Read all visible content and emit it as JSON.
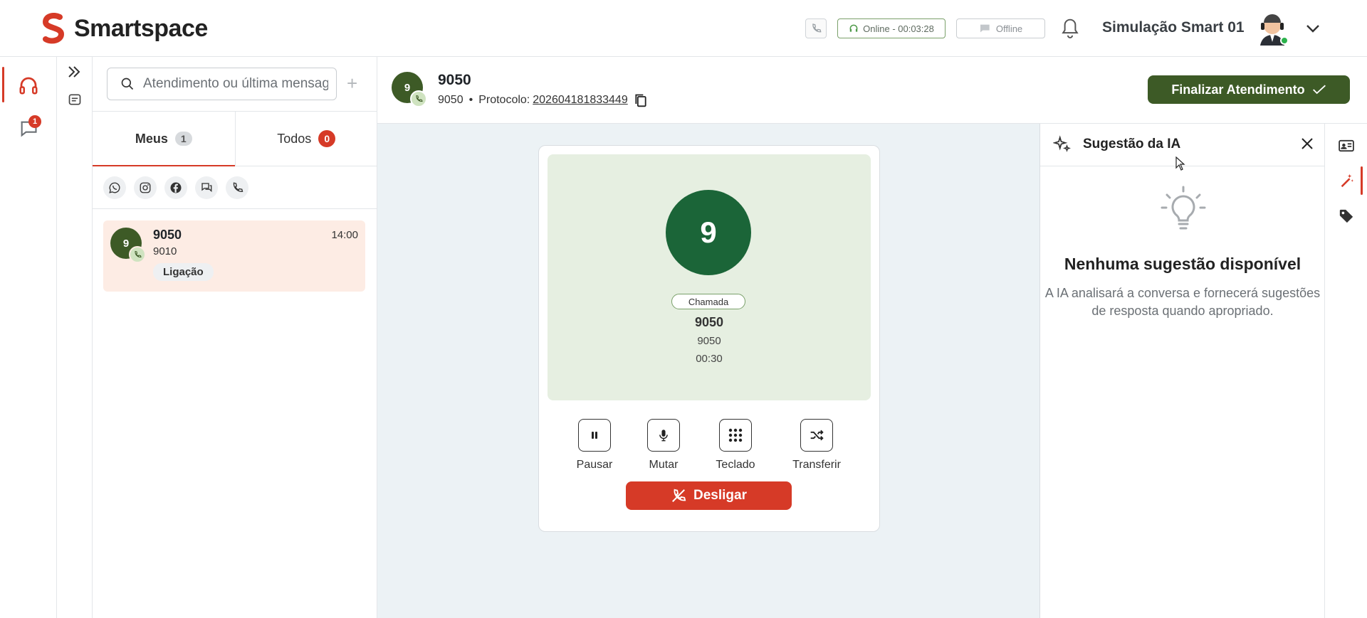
{
  "app": {
    "name": "Smartspace"
  },
  "topbar": {
    "status_online": "Online - 00:03:28",
    "status_offline": "Offline",
    "user_name": "Simulação Smart 01"
  },
  "rail": {
    "chat_badge": "1"
  },
  "list": {
    "search_placeholder": "Atendimento ou última mensagem",
    "plus_label": "+",
    "tabs": [
      {
        "label": "Meus",
        "count": "1"
      },
      {
        "label": "Todos",
        "count": "0"
      }
    ],
    "channels": [
      "whatsapp-icon",
      "instagram-icon",
      "facebook-icon",
      "chat-icon",
      "phone-icon"
    ],
    "conversations": [
      {
        "avatar": "9",
        "name": "9050",
        "time": "14:00",
        "subtitle": "9010",
        "tag": "Ligação"
      }
    ]
  },
  "header": {
    "avatar": "9",
    "title": "9050",
    "number": "9050",
    "separator": "•",
    "protocol_label": "Protocolo:",
    "protocol_number": "202604181833449",
    "finalize_label": "Finalizar Atendimento"
  },
  "call": {
    "avatar": "9",
    "badge": "Chamada",
    "name": "9050",
    "number": "9050",
    "timer": "00:30",
    "controls": [
      {
        "label": "Pausar",
        "icon": "pause-icon"
      },
      {
        "label": "Mutar",
        "icon": "mic-icon"
      },
      {
        "label": "Teclado",
        "icon": "keypad-icon"
      },
      {
        "label": "Transferir",
        "icon": "shuffle-icon"
      }
    ],
    "hangup_label": "Desligar"
  },
  "ai": {
    "title": "Sugestão da IA",
    "empty_title": "Nenhuma sugestão disponível",
    "empty_text": "A IA analisará a conversa e fornecerá sugestões de resposta quando apropriado."
  },
  "colors": {
    "brand_red": "#d63a27",
    "dark_green": "#3d5a26",
    "call_green": "#1b6538",
    "call_bg": "#e6efe1",
    "area_bg": "#ecf2f5"
  }
}
